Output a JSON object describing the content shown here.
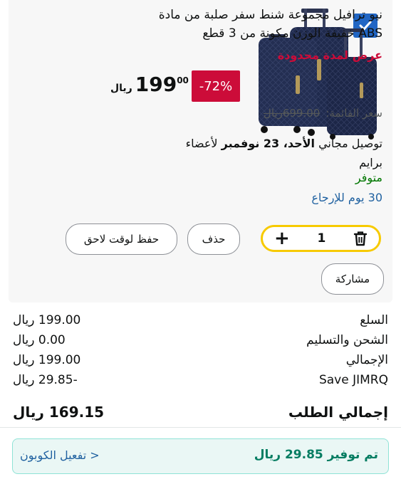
{
  "product": {
    "title": "نيو ترافيل مجموعة شنط سفر صلبة من مادة ABS خفيفة الوزن مكونة من 3 قطع",
    "deal_badge": "عرض لمدة محدودة",
    "discount": "-72%",
    "price_currency": "ريال",
    "price_whole": "199",
    "price_fraction": "00",
    "list_price_label": "سعر القائمة:",
    "list_price": "699.00ريال",
    "delivery_prefix": "توصيل مجاني",
    "delivery_date": "الأحد، 23 نوفمبر",
    "delivery_suffix": "لأعضاء برايم",
    "stock": "متوفر",
    "returns": "30 يوم للإرجاع",
    "image_icon": "luggage-set-image",
    "selected": true
  },
  "actions": {
    "quantity": "1",
    "delete_label": "حذف",
    "save_later_label": "حفظ لوقت لاحق",
    "share_label": "مشاركة"
  },
  "summary": {
    "rows": [
      {
        "label": "السلع",
        "value": "199.00 ريال"
      },
      {
        "label": "الشحن والتسليم",
        "value": "0.00 ريال"
      },
      {
        "label": "الإجمالي",
        "value": "199.00 ريال"
      },
      {
        "label": "Save JIMRQ",
        "value": "-29.85 ريال"
      }
    ],
    "total_label": "إجمالي الطلب",
    "total_value": "169.15 ريال"
  },
  "savings": {
    "text": "تم توفير 29.85 ريال",
    "coupon_link": "تفعيل الكوبون >"
  },
  "colors": {
    "deal_red": "#cc0c39",
    "stock_green": "#007600",
    "link_blue": "#2162a1",
    "stepper_yellow": "#f7ca00",
    "savings_green": "#067d62"
  }
}
